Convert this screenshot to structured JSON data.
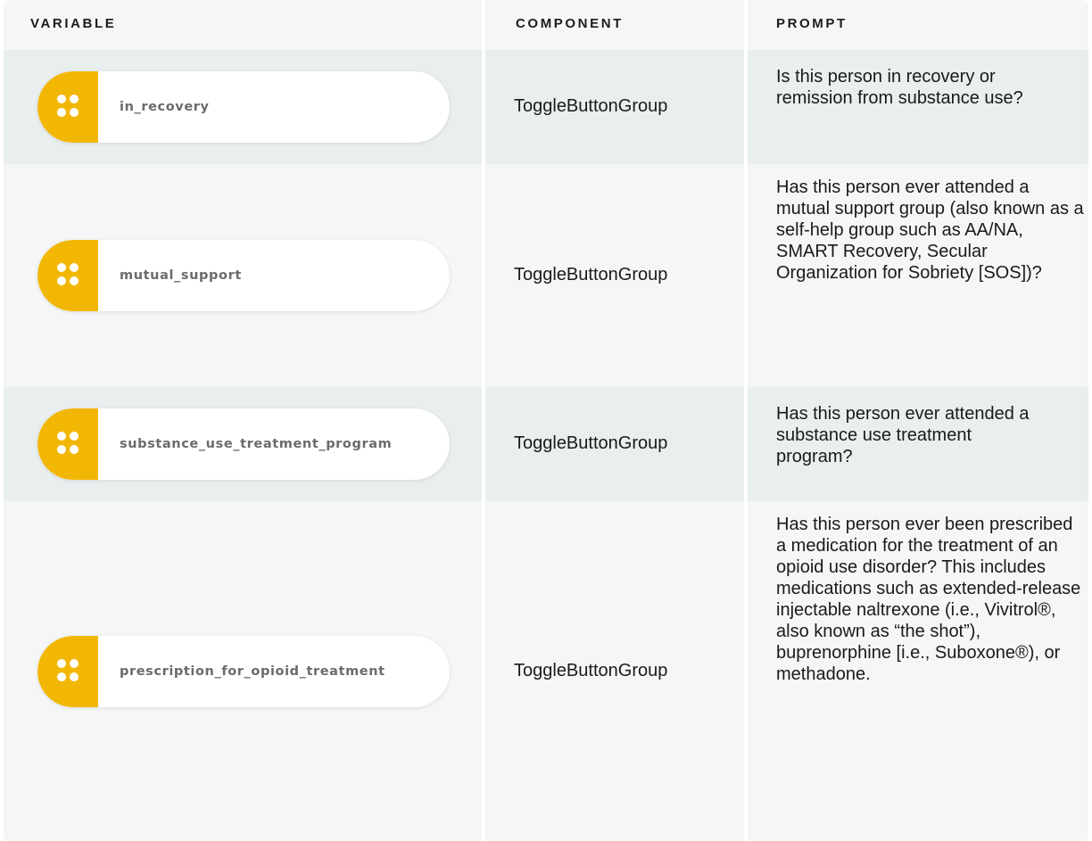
{
  "headers": {
    "variable": "VARIABLE",
    "component": "COMPONENT",
    "prompt": "PROMPT"
  },
  "colors": {
    "handle": "#f2b705",
    "row_alt": "#e9eeef",
    "row_plain": "#f4f6f7",
    "chip_text": "#6b6b6b"
  },
  "rows": [
    {
      "variable": "in_recovery",
      "component": "ToggleButtonGroup",
      "prompt": "Is this person in recovery or remission from substance use?",
      "handle_icon": "drag-handle-icon"
    },
    {
      "variable": "mutual_support",
      "component": "ToggleButtonGroup",
      "prompt": "Has this person ever attended a mutual support group (also known as a self-help group such as AA/NA, SMART Recovery, Secular Organization for Sobriety [SOS])?",
      "handle_icon": "drag-handle-icon"
    },
    {
      "variable": "substance_use_treatment_program",
      "component": "ToggleButtonGroup",
      "prompt": "Has this person ever attended a substance use treatment program?",
      "handle_icon": "drag-handle-icon"
    },
    {
      "variable": "prescription_for_opioid_treatment",
      "component": "ToggleButtonGroup",
      "prompt": "Has this person ever been prescribed a medication for the treatment of an opioid use disorder? This includes medications such as extended-release injectable naltrexone (i.e., Vivitrol®, also known as “the shot”), buprenorphine [i.e., Suboxone®), or methadone.",
      "handle_icon": "drag-handle-icon"
    }
  ]
}
